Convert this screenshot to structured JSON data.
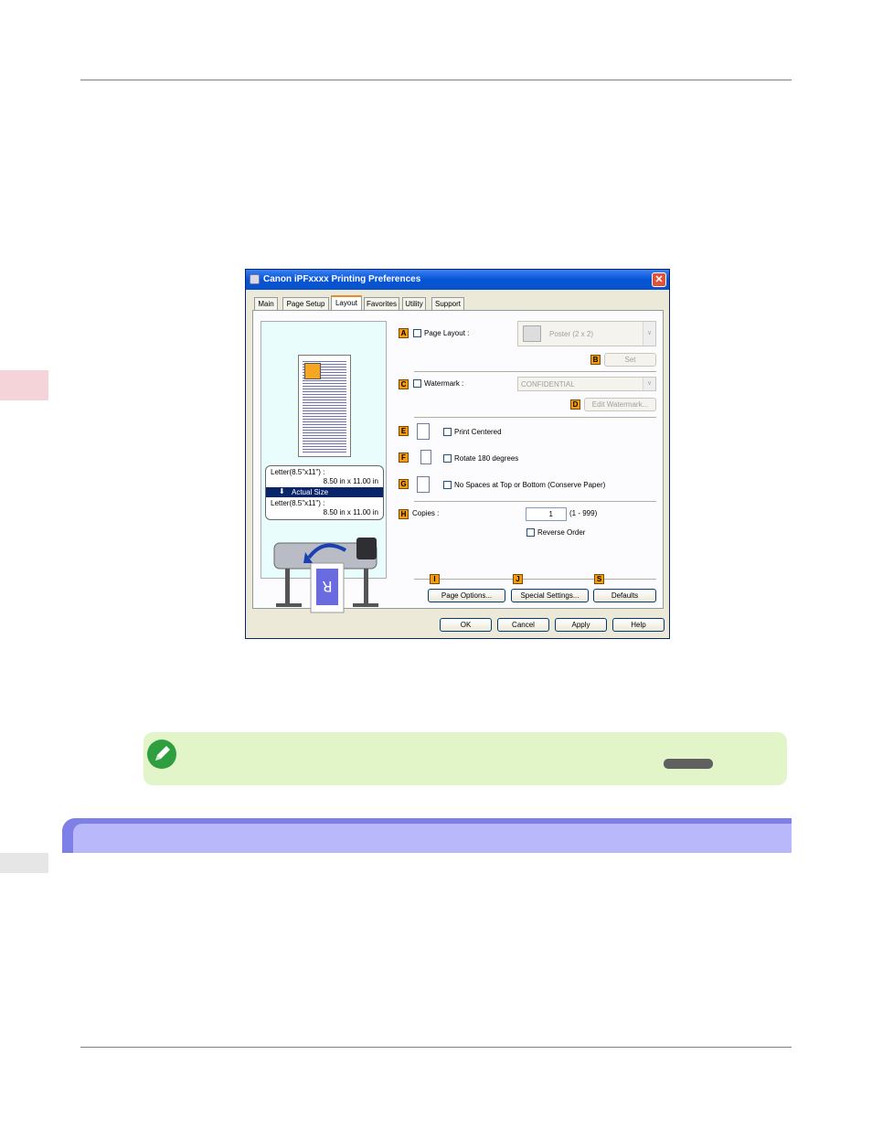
{
  "dialog": {
    "title": "Canon iPFxxxx Printing Preferences",
    "close": "✕",
    "tabs": [
      "Main",
      "Page Setup",
      "Layout",
      "Favorites",
      "Utility",
      "Support"
    ],
    "active_tab": "Layout",
    "preview": {
      "size_line1": "Letter(8.5\"x11\") :",
      "size_line1_value": "8.50 in x 11.00 in",
      "scale_label": "Actual Size",
      "size_line2": "Letter(8.5\"x11\") :",
      "size_line2_value": "8.50 in x 11.00 in",
      "printed_letter": "R"
    },
    "labels": {
      "A": "A",
      "B": "B",
      "C": "C",
      "D": "D",
      "E": "E",
      "F": "F",
      "G": "G",
      "H": "H",
      "I": "I",
      "J": "J",
      "S": "S"
    },
    "page_layout": {
      "label": "Page Layout :",
      "value": "Poster (2 x 2)",
      "set_button": "Set"
    },
    "watermark": {
      "label": "Watermark :",
      "value": "CONFIDENTIAL",
      "edit_button": "Edit Watermark..."
    },
    "print_centered": "Print Centered",
    "rotate": "Rotate 180 degrees",
    "no_spaces": "No Spaces at Top or Bottom (Conserve Paper)",
    "copies": {
      "label": "Copies :",
      "value": "1",
      "range": "(1 - 999)",
      "reverse_order": "Reverse Order"
    },
    "bottom_buttons": {
      "page_options": "Page Options...",
      "special_settings": "Special Settings...",
      "defaults": "Defaults"
    },
    "footer": {
      "ok": "OK",
      "cancel": "Cancel",
      "apply": "Apply",
      "help": "Help"
    }
  }
}
